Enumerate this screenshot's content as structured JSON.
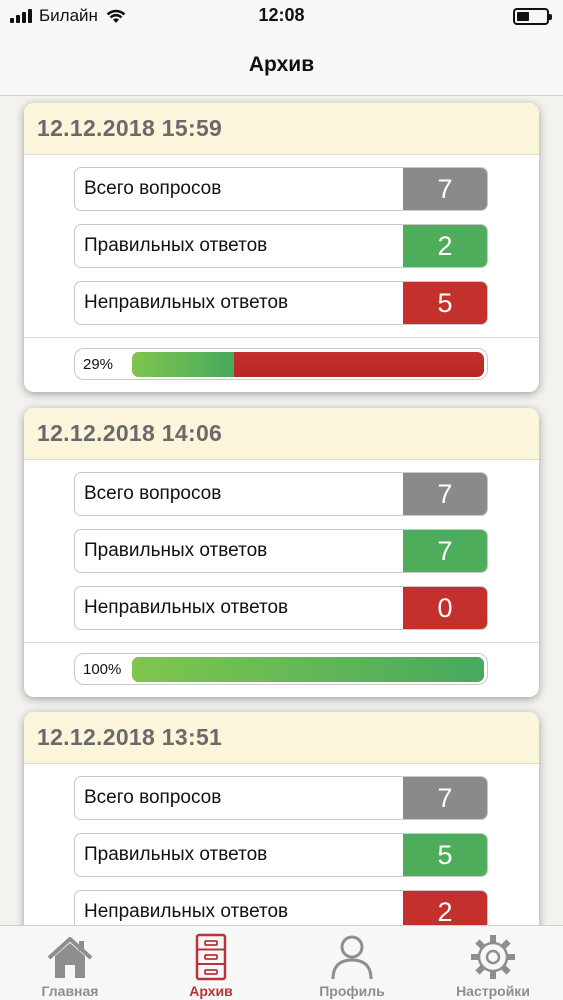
{
  "status_bar": {
    "carrier": "Билайн",
    "time": "12:08"
  },
  "nav": {
    "title": "Архив"
  },
  "cards": [
    {
      "date": "12.12.2018 15:59",
      "total_label": "Всего вопросов",
      "total": "7",
      "correct_label": "Правильных ответов",
      "correct": "2",
      "wrong_label": "Неправильных ответов",
      "wrong": "5",
      "percent_label": "29%",
      "percent": 29
    },
    {
      "date": "12.12.2018 14:06",
      "total_label": "Всего вопросов",
      "total": "7",
      "correct_label": "Правильных ответов",
      "correct": "7",
      "wrong_label": "Неправильных ответов",
      "wrong": "0",
      "percent_label": "100%",
      "percent": 100
    },
    {
      "date": "12.12.2018 13:51",
      "total_label": "Всего вопросов",
      "total": "7",
      "correct_label": "Правильных ответов",
      "correct": "5",
      "wrong_label": "Неправильных ответов",
      "wrong": "2"
    }
  ],
  "tabs": [
    {
      "label": "Главная",
      "icon": "home-icon",
      "active": false
    },
    {
      "label": "Архив",
      "icon": "archive-icon",
      "active": true
    },
    {
      "label": "Профиль",
      "icon": "profile-icon",
      "active": false
    },
    {
      "label": "Настройки",
      "icon": "settings-icon",
      "active": false
    }
  ],
  "colors": {
    "header_bg": "#fbf5dc",
    "gray": "#8a8a8a",
    "green": "#4ead5b",
    "red": "#c4302b",
    "active_tab": "#b8343a",
    "inactive_tab": "#8e8e8e"
  }
}
